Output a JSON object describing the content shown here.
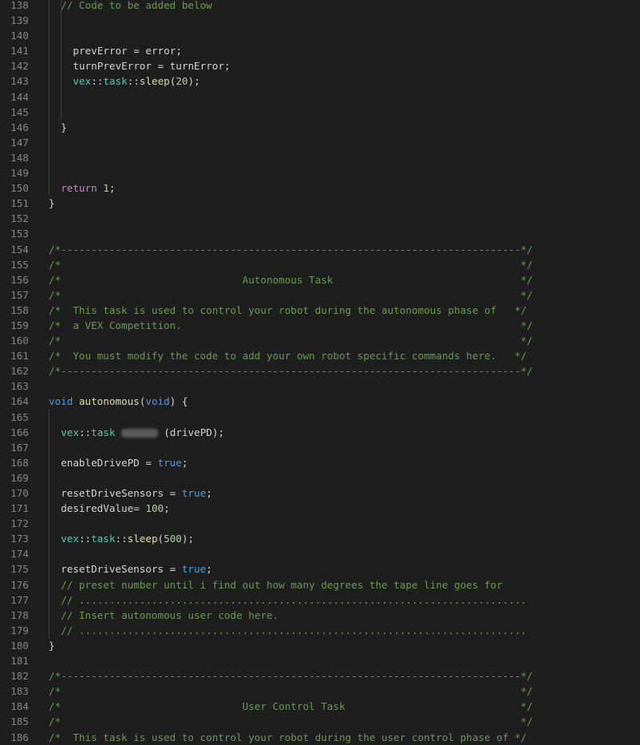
{
  "editor": {
    "lines": [
      {
        "n": "138",
        "indent": 1,
        "guides": [
          0,
          1
        ],
        "tokens": [
          {
            "t": "// Code to be added below",
            "c": "comment"
          }
        ]
      },
      {
        "n": "139",
        "indent": 0,
        "guides": [
          0,
          1
        ],
        "tokens": []
      },
      {
        "n": "140",
        "indent": 0,
        "guides": [
          0,
          1
        ],
        "tokens": []
      },
      {
        "n": "141",
        "indent": 2,
        "guides": [
          0,
          1
        ],
        "tokens": [
          {
            "t": "prevError",
            "c": "ident"
          },
          {
            "t": " = ",
            "c": "plain"
          },
          {
            "t": "error",
            "c": "ident"
          },
          {
            "t": ";",
            "c": "plain"
          }
        ]
      },
      {
        "n": "142",
        "indent": 2,
        "guides": [
          0,
          1
        ],
        "tokens": [
          {
            "t": "turnPrevError",
            "c": "ident"
          },
          {
            "t": " = ",
            "c": "plain"
          },
          {
            "t": "turnError",
            "c": "ident"
          },
          {
            "t": ";",
            "c": "plain"
          }
        ]
      },
      {
        "n": "143",
        "indent": 2,
        "guides": [
          0,
          1
        ],
        "tokens": [
          {
            "t": "vex",
            "c": "ns"
          },
          {
            "t": "::",
            "c": "plain"
          },
          {
            "t": "task",
            "c": "ns"
          },
          {
            "t": "::",
            "c": "plain"
          },
          {
            "t": "sleep",
            "c": "func"
          },
          {
            "t": "(",
            "c": "plain"
          },
          {
            "t": "20",
            "c": "number"
          },
          {
            "t": ");",
            "c": "plain"
          }
        ]
      },
      {
        "n": "144",
        "indent": 0,
        "guides": [
          0,
          1
        ],
        "tokens": []
      },
      {
        "n": "145",
        "indent": 0,
        "guides": [
          0,
          1
        ],
        "tokens": []
      },
      {
        "n": "146",
        "indent": 1,
        "guides": [
          0
        ],
        "tokens": [
          {
            "t": "}",
            "c": "plain"
          }
        ]
      },
      {
        "n": "147",
        "indent": 0,
        "guides": [
          0
        ],
        "tokens": []
      },
      {
        "n": "148",
        "indent": 0,
        "guides": [
          0
        ],
        "tokens": []
      },
      {
        "n": "149",
        "indent": 0,
        "guides": [
          0
        ],
        "tokens": []
      },
      {
        "n": "150",
        "indent": 1,
        "guides": [
          0
        ],
        "tokens": [
          {
            "t": "return",
            "c": "keyword"
          },
          {
            "t": " ",
            "c": "plain"
          },
          {
            "t": "1",
            "c": "number"
          },
          {
            "t": ";",
            "c": "plain"
          }
        ]
      },
      {
        "n": "151",
        "indent": 0,
        "guides": [],
        "tokens": [
          {
            "t": "}",
            "c": "plain"
          }
        ]
      },
      {
        "n": "152",
        "indent": 0,
        "guides": [],
        "tokens": []
      },
      {
        "n": "153",
        "indent": 0,
        "guides": [],
        "tokens": []
      },
      {
        "n": "154",
        "indent": 0,
        "guides": [],
        "tokens": [
          {
            "t": "/*----------------------------------------------------------------------------*/",
            "c": "comment"
          }
        ]
      },
      {
        "n": "155",
        "indent": 0,
        "guides": [],
        "tokens": [
          {
            "t": "/*                                                                            */",
            "c": "comment"
          }
        ]
      },
      {
        "n": "156",
        "indent": 0,
        "guides": [],
        "tokens": [
          {
            "t": "/*                              Autonomous Task                               */",
            "c": "comment"
          }
        ]
      },
      {
        "n": "157",
        "indent": 0,
        "guides": [],
        "tokens": [
          {
            "t": "/*                                                                            */",
            "c": "comment"
          }
        ]
      },
      {
        "n": "158",
        "indent": 0,
        "guides": [],
        "tokens": [
          {
            "t": "/*  This task is used to control your robot during the autonomous phase of   */",
            "c": "comment"
          }
        ]
      },
      {
        "n": "159",
        "indent": 0,
        "guides": [],
        "tokens": [
          {
            "t": "/*  a VEX Competition.                                                        */",
            "c": "comment"
          }
        ]
      },
      {
        "n": "160",
        "indent": 0,
        "guides": [],
        "tokens": [
          {
            "t": "/*                                                                            */",
            "c": "comment"
          }
        ]
      },
      {
        "n": "161",
        "indent": 0,
        "guides": [],
        "tokens": [
          {
            "t": "/*  You must modify the code to add your own robot specific commands here.   */",
            "c": "comment"
          }
        ]
      },
      {
        "n": "162",
        "indent": 0,
        "guides": [],
        "tokens": [
          {
            "t": "/*----------------------------------------------------------------------------*/",
            "c": "comment"
          }
        ]
      },
      {
        "n": "163",
        "indent": 0,
        "guides": [],
        "tokens": []
      },
      {
        "n": "164",
        "indent": 0,
        "guides": [],
        "tokens": [
          {
            "t": "void",
            "c": "type"
          },
          {
            "t": " ",
            "c": "plain"
          },
          {
            "t": "autonomous",
            "c": "func"
          },
          {
            "t": "(",
            "c": "plain"
          },
          {
            "t": "void",
            "c": "type"
          },
          {
            "t": ") {",
            "c": "plain"
          }
        ]
      },
      {
        "n": "165",
        "indent": 0,
        "guides": [
          0
        ],
        "tokens": []
      },
      {
        "n": "166",
        "indent": 1,
        "guides": [
          0
        ],
        "tokens": [
          {
            "t": "vex",
            "c": "ns"
          },
          {
            "t": "::",
            "c": "plain"
          },
          {
            "t": "task",
            "c": "ns"
          },
          {
            "t": " ",
            "c": "plain"
          },
          {
            "t": "      ",
            "c": "redact"
          },
          {
            "t": " (drivePD);",
            "c": "plain"
          }
        ]
      },
      {
        "n": "167",
        "indent": 0,
        "guides": [
          0
        ],
        "tokens": []
      },
      {
        "n": "168",
        "indent": 1,
        "guides": [
          0
        ],
        "tokens": [
          {
            "t": "enableDrivePD",
            "c": "ident"
          },
          {
            "t": " = ",
            "c": "plain"
          },
          {
            "t": "true",
            "c": "type"
          },
          {
            "t": ";",
            "c": "plain"
          }
        ]
      },
      {
        "n": "169",
        "indent": 0,
        "guides": [
          0
        ],
        "tokens": []
      },
      {
        "n": "170",
        "indent": 1,
        "guides": [
          0
        ],
        "tokens": [
          {
            "t": "resetDriveSensors",
            "c": "ident"
          },
          {
            "t": " = ",
            "c": "plain"
          },
          {
            "t": "true",
            "c": "type"
          },
          {
            "t": ";",
            "c": "plain"
          }
        ]
      },
      {
        "n": "171",
        "indent": 1,
        "guides": [
          0
        ],
        "tokens": [
          {
            "t": "desiredValue",
            "c": "ident"
          },
          {
            "t": "= ",
            "c": "plain"
          },
          {
            "t": "100",
            "c": "number"
          },
          {
            "t": ";",
            "c": "plain"
          }
        ]
      },
      {
        "n": "172",
        "indent": 0,
        "guides": [
          0
        ],
        "tokens": []
      },
      {
        "n": "173",
        "indent": 1,
        "guides": [
          0
        ],
        "tokens": [
          {
            "t": "vex",
            "c": "ns"
          },
          {
            "t": "::",
            "c": "plain"
          },
          {
            "t": "task",
            "c": "ns"
          },
          {
            "t": "::",
            "c": "plain"
          },
          {
            "t": "sleep",
            "c": "func"
          },
          {
            "t": "(",
            "c": "plain"
          },
          {
            "t": "500",
            "c": "number"
          },
          {
            "t": ");",
            "c": "plain"
          }
        ]
      },
      {
        "n": "174",
        "indent": 0,
        "guides": [
          0
        ],
        "tokens": []
      },
      {
        "n": "175",
        "indent": 1,
        "guides": [
          0
        ],
        "tokens": [
          {
            "t": "resetDriveSensors",
            "c": "ident"
          },
          {
            "t": " = ",
            "c": "plain"
          },
          {
            "t": "true",
            "c": "type"
          },
          {
            "t": ";",
            "c": "plain"
          }
        ]
      },
      {
        "n": "176",
        "indent": 1,
        "guides": [
          0
        ],
        "tokens": [
          {
            "t": "// preset number until i find out how many degrees the tape line goes for",
            "c": "comment"
          }
        ]
      },
      {
        "n": "177",
        "indent": 1,
        "guides": [
          0
        ],
        "tokens": [
          {
            "t": "// ..........................................................................",
            "c": "comment"
          }
        ]
      },
      {
        "n": "178",
        "indent": 1,
        "guides": [
          0
        ],
        "tokens": [
          {
            "t": "// Insert autonomous user code here.",
            "c": "comment"
          }
        ]
      },
      {
        "n": "179",
        "indent": 1,
        "guides": [
          0
        ],
        "tokens": [
          {
            "t": "// ..........................................................................",
            "c": "comment"
          }
        ]
      },
      {
        "n": "180",
        "indent": 0,
        "guides": [],
        "tokens": [
          {
            "t": "}",
            "c": "plain"
          }
        ]
      },
      {
        "n": "181",
        "indent": 0,
        "guides": [],
        "tokens": []
      },
      {
        "n": "182",
        "indent": 0,
        "guides": [],
        "tokens": [
          {
            "t": "/*----------------------------------------------------------------------------*/",
            "c": "comment"
          }
        ]
      },
      {
        "n": "183",
        "indent": 0,
        "guides": [],
        "tokens": [
          {
            "t": "/*                                                                            */",
            "c": "comment"
          }
        ]
      },
      {
        "n": "184",
        "indent": 0,
        "guides": [],
        "tokens": [
          {
            "t": "/*                              User Control Task                             */",
            "c": "comment"
          }
        ]
      },
      {
        "n": "185",
        "indent": 0,
        "guides": [],
        "tokens": [
          {
            "t": "/*                                                                            */",
            "c": "comment"
          }
        ]
      },
      {
        "n": "186",
        "indent": 0,
        "guides": [],
        "tokens": [
          {
            "t": "/*  This task is used to control your robot during the user control phase of */",
            "c": "comment"
          }
        ]
      }
    ]
  }
}
